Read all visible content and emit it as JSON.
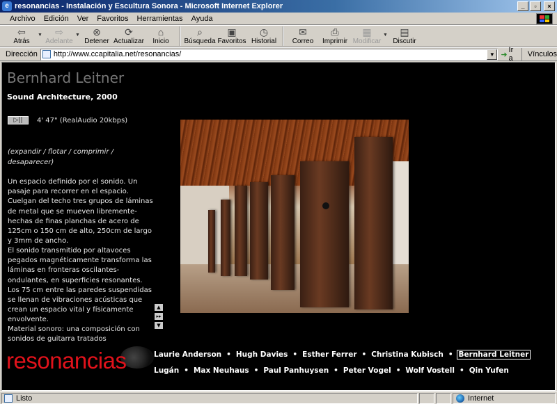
{
  "window": {
    "title": "resonancias - Instalación y Escultura Sonora - Microsoft Internet Explorer",
    "min": "_",
    "max": "▫",
    "close": "×"
  },
  "menu": [
    "Archivo",
    "Edición",
    "Ver",
    "Favoritos",
    "Herramientas",
    "Ayuda"
  ],
  "toolbar": {
    "back": "Atrás",
    "forward": "Adelante",
    "stop": "Detener",
    "refresh": "Actualizar",
    "home": "Inicio",
    "search": "Búsqueda",
    "favorites": "Favoritos",
    "history": "Historial",
    "mail": "Correo",
    "print": "Imprimir",
    "edit": "Modificar",
    "discuss": "Discutir"
  },
  "address": {
    "label": "Dirección",
    "url": "http://www.ccapitalia.net/resonancias/",
    "go": "Ir a",
    "links": "Vínculos"
  },
  "page": {
    "artist": "Bernhard Leitner",
    "work": "Sound Architecture, 2000",
    "play_icon": "▷||",
    "duration": "4' 47\" (RealAudio 20kbps)",
    "controls": "(expandir / flotar / comprimir / desaparecer)",
    "desc1": "Un espacio definido por el sonido. Un pasaje para recorrer en el espacio. Cuelgan del techo tres grupos de láminas de metal que se mueven libremente-hechas de finas planchas de acero de 125cm o 150 cm de alto, 250cm de largo y 3mm de ancho.",
    "desc2": "El sonido transmitido por altavoces pegados magnéticamente transforma las láminas en fronteras oscilantes-ondulantes, en superficies resonantes. Los 75 cm entre las paredes suspendidas se llenan de vibraciones acústicas que crean un espacio vital y físicamente envolvente.",
    "desc3": "Material sonoro: una composición con sonidos de guitarra tratados",
    "logo": "resonancias",
    "artists_row1": [
      "Laurie Anderson",
      "Hugh Davies",
      "Esther Ferrer",
      "Christina Kubisch",
      "Bernhard Leitner"
    ],
    "artists_row2": [
      "Lugán",
      "Max Neuhaus",
      "Paul Panhuysen",
      "Peter Vogel",
      "Wolf Vostell",
      "Qin Yufen"
    ],
    "scroll_up": "▲",
    "scroll_ff": "▸▸",
    "scroll_down": "▼"
  },
  "status": {
    "text": "Listo",
    "zone": "Internet"
  },
  "colors": {
    "titlebar": "#0a246a",
    "logo_red": "#e0121b",
    "page_bg": "#000000"
  }
}
